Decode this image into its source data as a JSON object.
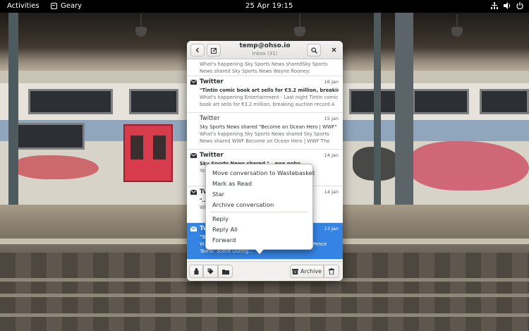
{
  "topbar": {
    "activities": "Activities",
    "app_name": "Geary",
    "clock": "25 Apr  19:15"
  },
  "window": {
    "title": "temp@ohso.io",
    "subtitle": "Inbox (31)"
  },
  "messages": [
    {
      "sender": "",
      "date": "",
      "subject": "",
      "preview": "What's happening Sky Sports News sharedSky Sports News shared Sky Sports News Wayne Rooney: Manchester United will ...",
      "unread": false,
      "selected": false
    },
    {
      "sender": "Twitter",
      "date": "16 Jan",
      "subject": "\"Tintin comic book art sells for €3.2 million, breaking aucti",
      "preview": "What's happening Entertainment - Last night Tintin comic book art sells for €3.2 million, breaking auction record A Ti...",
      "unread": true,
      "selected": false
    },
    {
      "sender": "Twitter",
      "date": "15 Jan",
      "subject": "Sky Sports News shared \"Become an Ocean Hero | WWF\"",
      "preview": "What's happening Sky Sports News shared Sky Sports News shared WWF Become an Ocean Hero | WWF The Ocean He...",
      "unread": false,
      "selected": false
    },
    {
      "sender": "Twitter",
      "date": "14 Jan",
      "subject": "Sky Sports News shared \"...ews nobo...",
      "preview": "You... ...News Scott Par... ...a strong...",
      "unread": true,
      "selected": false
    },
    {
      "sender": "Twitter",
      "date": "14 Jan",
      "subject": "\"...o impeach...",
      "preview": "Wh... ...k at the 10... ...p On W...",
      "unread": true,
      "selected": false
    },
    {
      "sender": "Twitter",
      "date": "13 Jan",
      "subject": "\"S... ...ence 'Bor...",
      "preview": "W... ...Baron Cohen reveals secret behind Mike Pence 'Borat' scene During...",
      "unread": true,
      "selected": true
    }
  ],
  "context_menu": {
    "group1": [
      "Move conversation to Wastebasket",
      "Mark as Read",
      "Star",
      "Archive conversation"
    ],
    "group2": [
      "Reply",
      "Reply All",
      "Forward"
    ]
  },
  "footer": {
    "archive_label": "Archive"
  },
  "colors": {
    "accent": "#3584e4",
    "topbar": "#000000"
  }
}
